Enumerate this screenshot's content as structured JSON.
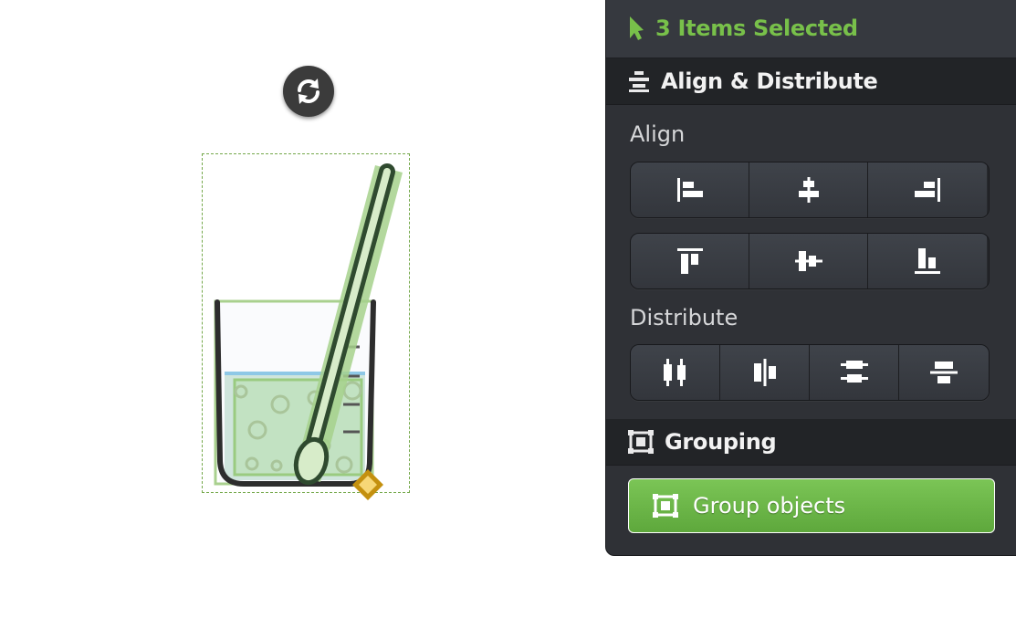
{
  "canvas": {
    "object_names": [
      "beaker-icon",
      "stirring-rod-icon",
      "liquid-icon"
    ]
  },
  "panel": {
    "selection_title": "3 Items Selected",
    "align_distribute": {
      "title": "Align & Distribute",
      "align_label": "Align",
      "align_buttons": [
        "align-left",
        "align-center-horizontal",
        "align-right",
        "align-top",
        "align-center-vertical",
        "align-bottom"
      ],
      "distribute_label": "Distribute",
      "distribute_buttons": [
        "distribute-left",
        "distribute-center-horizontal",
        "distribute-top",
        "distribute-center-vertical"
      ]
    },
    "grouping": {
      "title": "Grouping",
      "group_button_label": "Group objects"
    }
  },
  "colors": {
    "accent_green": "#78c04a",
    "panel_bg": "#2f3136",
    "selection_dash": "#74a84a",
    "handle_gold": "#c4900f"
  }
}
